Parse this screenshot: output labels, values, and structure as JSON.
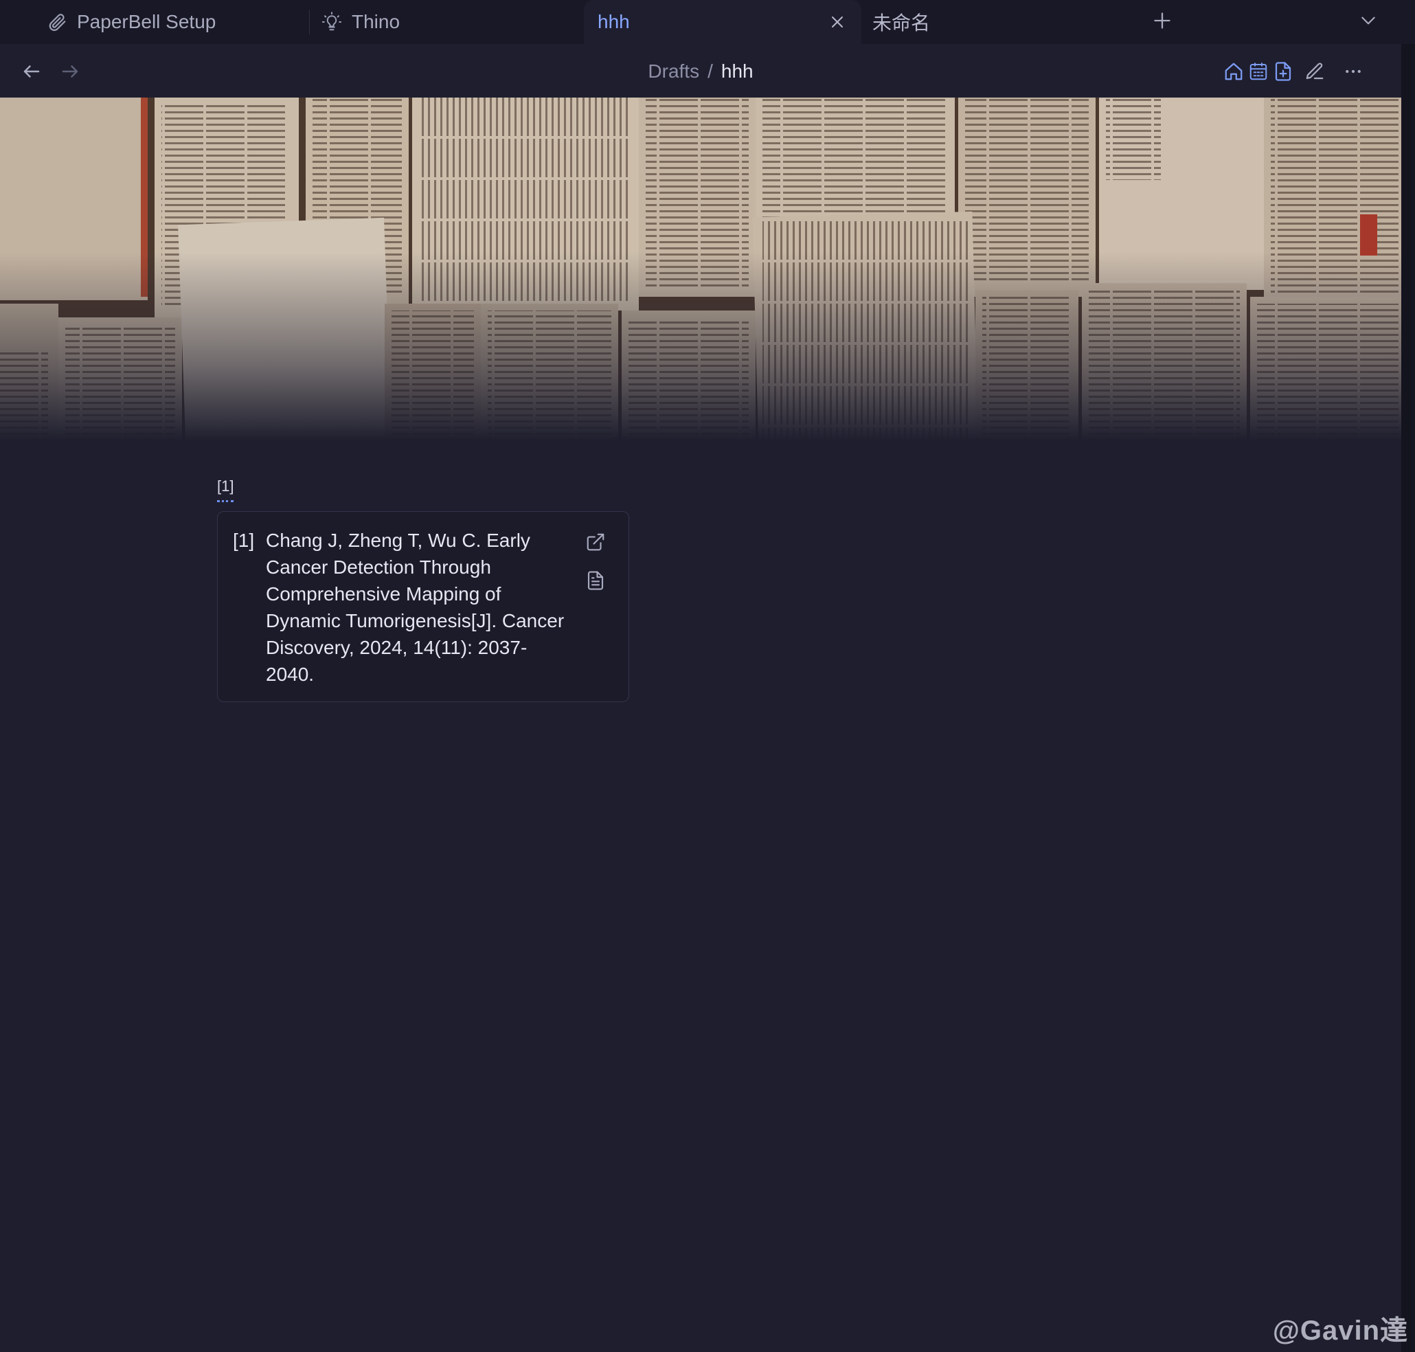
{
  "tabs": [
    {
      "label": "PaperBell Setup",
      "icon": "paperclip-icon",
      "active": false
    },
    {
      "label": "Thino",
      "icon": "lightbulb-icon",
      "active": false
    },
    {
      "label": "hhh",
      "icon": "",
      "active": true
    },
    {
      "label": "未命名",
      "icon": "",
      "active": false
    }
  ],
  "breadcrumb": {
    "folder": "Drafts",
    "separator": "/",
    "current": "hhh"
  },
  "header_actions": [
    "home-icon",
    "calendar-icon",
    "new-file-icon",
    "edit-icon",
    "more-options-icon"
  ],
  "banner": {
    "icon": "open-books-image"
  },
  "citation": {
    "ref_label": "[1]",
    "number": "[1]",
    "text": "Chang J, Zheng T, Wu C. Early Cancer Detection Through Comprehensive Mapping of Dynamic Tumorigenesis[J]. Cancer Discovery, 2024, 14(11): 2037-2040."
  },
  "watermark": "@Gavin達",
  "colors": {
    "background": "#1e1e2e",
    "tabbar": "#181826",
    "accent": "#8aa7ff",
    "text": "#e6e7f1",
    "muted": "#8d8fa6"
  }
}
